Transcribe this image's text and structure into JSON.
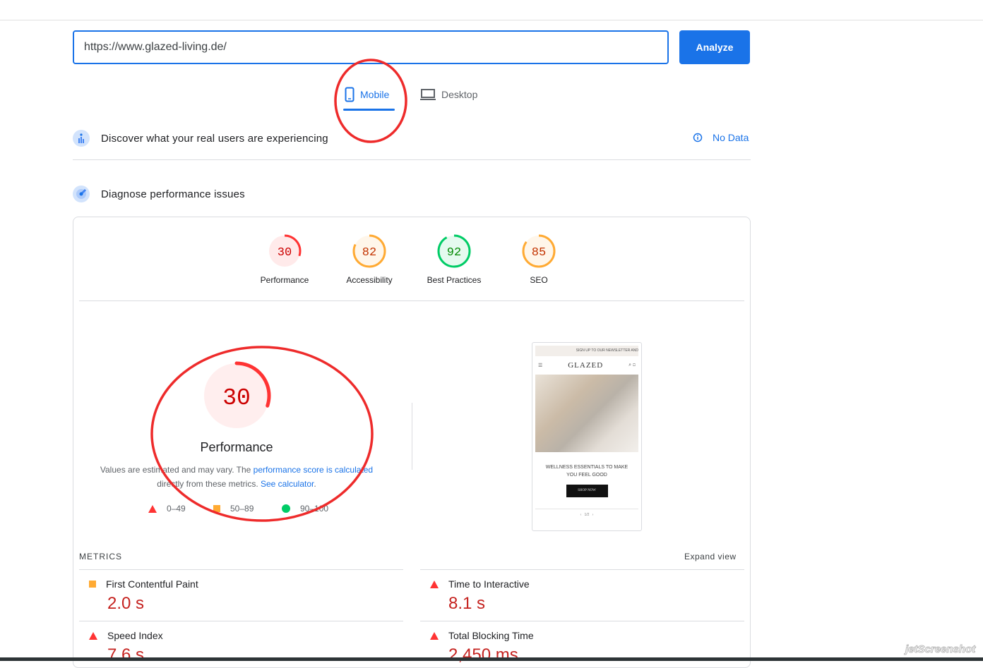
{
  "search": {
    "url": "https://www.glazed-living.de/",
    "analyze_label": "Analyze"
  },
  "tabs": [
    {
      "label": "Mobile"
    },
    {
      "label": "Desktop"
    }
  ],
  "field_data": {
    "title": "Discover what your real users are experiencing",
    "status": "No Data"
  },
  "lab": {
    "title": "Diagnose performance issues"
  },
  "scores": [
    {
      "label": "Performance",
      "value": "30",
      "color": "#ff3333"
    },
    {
      "label": "Accessibility",
      "value": "82",
      "color": "#ffaa33"
    },
    {
      "label": "Best Practices",
      "value": "92",
      "color": "#00cc66"
    },
    {
      "label": "SEO",
      "value": "85",
      "color": "#ffaa33"
    }
  ],
  "main_score": {
    "value": "30",
    "label": "Performance",
    "desc1": "Values are estimated and may vary. The ",
    "link1": "performance score is calculated",
    "desc2": " directly from these metrics. ",
    "link2": "See calculator",
    "desc3": "."
  },
  "legend": [
    "0–49",
    "50–89",
    "90–100"
  ],
  "screenshot": {
    "banner": "SIGN UP TO OUR NEWSLETTER AND",
    "brand": "GLAZED",
    "headline": "WELLNESS ESSENTIALS TO MAKE YOU FEEL GOOD",
    "cta": "SHOP NOW",
    "pager": "1/2"
  },
  "metrics": {
    "heading": "METRICS",
    "expand": "Expand view",
    "items": [
      {
        "label": "First Contentful Paint",
        "value": "2.0 s",
        "rating": "average"
      },
      {
        "label": "Time to Interactive",
        "value": "8.1 s",
        "rating": "fail"
      },
      {
        "label": "Speed Index",
        "value": "7.6 s",
        "rating": "fail"
      },
      {
        "label": "Total Blocking Time",
        "value": "2,450 ms",
        "rating": "fail"
      }
    ]
  },
  "watermark": "jetScreenshot.com"
}
